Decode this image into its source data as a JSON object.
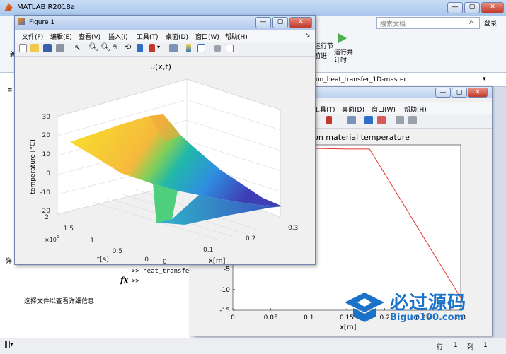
{
  "main": {
    "title": "MATLAB R2018a",
    "search_placeholder": "搜索文档",
    "login_label": "登录",
    "ribbon_left_char": "新",
    "ribbon_run_section": "运行节",
    "ribbon_advance": "前进",
    "ribbon_run_advance": "运行并\n计时",
    "path_tail": "on_heat_transfer_1D-master",
    "detail_hint": "选择文件以查看详细信息",
    "detail_tab_char": "详",
    "cmd_line1": ">> heat_transfer",
    "cmd_prompt": ">>",
    "fx": "fx",
    "status_row_label": "行",
    "status_row_val": "1",
    "status_col_label": "列",
    "status_col_val": "1"
  },
  "fig1": {
    "title": "Figure 1",
    "menus": [
      "文件(F)",
      "编辑(E)",
      "查看(V)",
      "插入(I)",
      "工具(T)",
      "桌面(D)",
      "窗口(W)",
      "帮助(H)"
    ],
    "chart_title": "u(x,t)"
  },
  "fig2": {
    "menus": [
      "工具(T)",
      "桌面(D)",
      "窗口(W)",
      "帮助(H)"
    ],
    "chart_title_fragment": "ation material temperature"
  },
  "watermark": {
    "brand": "必过源码",
    "url": "Biguo100.com"
  },
  "chart_data": [
    {
      "type": "surface",
      "title": "u(x,t)",
      "xlabel": "x[m]",
      "ylabel": "t[s]",
      "zlabel": "temperature [°C]",
      "x_ticks": [
        "0",
        "0.1",
        "0.2",
        "0.3"
      ],
      "y_ticks": [
        "0",
        "0.5",
        "1",
        "1.5",
        "2"
      ],
      "y_exponent": "×10^5",
      "z_ticks": [
        "-20",
        "-10",
        "0",
        "10",
        "20",
        "30"
      ],
      "xlim": [
        0,
        0.3
      ],
      "ylim": [
        0,
        200000
      ],
      "zlim": [
        -20,
        30
      ],
      "x": [
        0,
        0.05,
        0.1,
        0.15,
        0.2,
        0.25,
        0.3
      ],
      "profile_t0": [
        22,
        22,
        22,
        -18,
        -18,
        -18,
        -18
      ],
      "profile_tmax": [
        26,
        24,
        22,
        8,
        -5,
        -12,
        -16
      ],
      "colormap": "parula"
    },
    {
      "type": "line",
      "title": "ation material temperature",
      "xlabel": "x[m]",
      "x_ticks": [
        "0",
        "0.05",
        "0.1",
        "0.15",
        "0.2",
        "0.25",
        "0.3"
      ],
      "y_ticks": [
        "-15",
        "-10",
        "-5"
      ],
      "xlim": [
        0,
        0.3
      ],
      "ylim": [
        -15,
        25
      ],
      "series": [
        {
          "color": "#e8322e",
          "x": [
            0,
            0.15,
            0.18,
            0.3
          ],
          "y": [
            24.5,
            24,
            24,
            -12
          ]
        }
      ]
    }
  ]
}
